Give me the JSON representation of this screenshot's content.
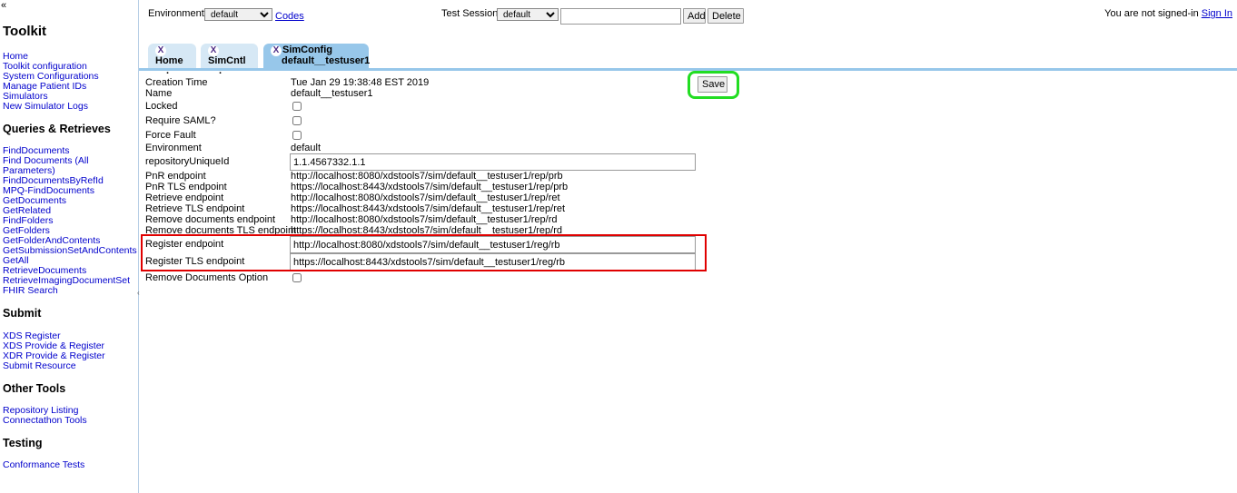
{
  "sidebar": {
    "collapse": "«",
    "title": "Toolkit",
    "links_main": [
      "Home",
      "Toolkit configuration",
      "System Configurations",
      "Manage Patient IDs",
      "Simulators",
      "New Simulator Logs"
    ],
    "queries_title": "Queries & Retrieves",
    "links_queries": [
      "FindDocuments",
      "Find Documents (All",
      "Parameters)",
      "FindDocumentsByRefId",
      "MPQ-FindDocuments",
      "GetDocuments",
      "GetRelated",
      "FindFolders",
      "GetFolders",
      "GetFolderAndContents",
      "GetSubmissionSetAndContents",
      "GetAll",
      "RetrieveDocuments",
      "RetrieveImagingDocumentSet",
      "FHIR Search"
    ],
    "submit_title": "Submit",
    "links_submit": [
      "XDS Register",
      "XDS Provide & Register",
      "XDR Provide & Register",
      "Submit Resource"
    ],
    "other_title": "Other Tools",
    "links_other": [
      "Repository Listing",
      "Connectathon Tools"
    ],
    "testing_title": "Testing",
    "links_testing": [
      "Conformance Tests"
    ]
  },
  "header": {
    "env_label": "Environment:",
    "env_value": "default",
    "codes_link": "Codes",
    "ts_label": "Test Session:",
    "ts_value": "default",
    "ts_input": "",
    "add_label": "Add",
    "delete_label": "Delete",
    "signin_text": "You are not signed-in",
    "signin_link": "Sign In"
  },
  "tabs": [
    {
      "close": "X",
      "label": "Home",
      "sub": "."
    },
    {
      "close": "X",
      "label": "SimCntl",
      "sub": "."
    },
    {
      "close": "X",
      "label": "SimConfig",
      "sub": "default__testuser1"
    }
  ],
  "config": {
    "save_label": "Save",
    "creation_time_label": "Creation Time",
    "creation_time": "Tue Jan 29 19:38:48 EST 2019",
    "name_label": "Name",
    "name": "default__testuser1",
    "locked_label": "Locked",
    "require_saml_label": "Require SAML?",
    "force_fault_label": "Force Fault",
    "environment_label": "Environment",
    "environment": "default",
    "repo_uid_label": "repositoryUniqueId",
    "repo_uid": "1.1.4567332.1.1",
    "pnr_label": "PnR endpoint",
    "pnr": "http://localhost:8080/xdstools7/sim/default__testuser1/rep/prb",
    "pnr_tls_label": "PnR TLS endpoint",
    "pnr_tls": "https://localhost:8443/xdstools7/sim/default__testuser1/rep/prb",
    "retrieve_label": "Retrieve endpoint",
    "retrieve": "http://localhost:8080/xdstools7/sim/default__testuser1/rep/ret",
    "retrieve_tls_label": "Retrieve TLS endpoint",
    "retrieve_tls": "https://localhost:8443/xdstools7/sim/default__testuser1/rep/ret",
    "remove_docs_label": "Remove documents endpoint",
    "remove_docs": "http://localhost:8080/xdstools7/sim/default__testuser1/rep/rd",
    "remove_docs_tls_label": "Remove documents TLS endpoint",
    "remove_docs_tls": "https://localhost:8443/xdstools7/sim/default__testuser1/rep/rd",
    "register_label": "Register endpoint",
    "register": "http://localhost:8080/xdstools7/sim/default__testuser1/reg/rb",
    "register_tls_label": "Register TLS endpoint",
    "register_tls": "https://localhost:8443/xdstools7/sim/default__testuser1/reg/rb",
    "remove_option_label": "Remove Documents Option"
  },
  "colors": {
    "tab_active": "#97c7ea",
    "tab_inactive": "#d6e8f5",
    "highlight_save": "#22dd22",
    "highlight_register": "#e00000"
  }
}
